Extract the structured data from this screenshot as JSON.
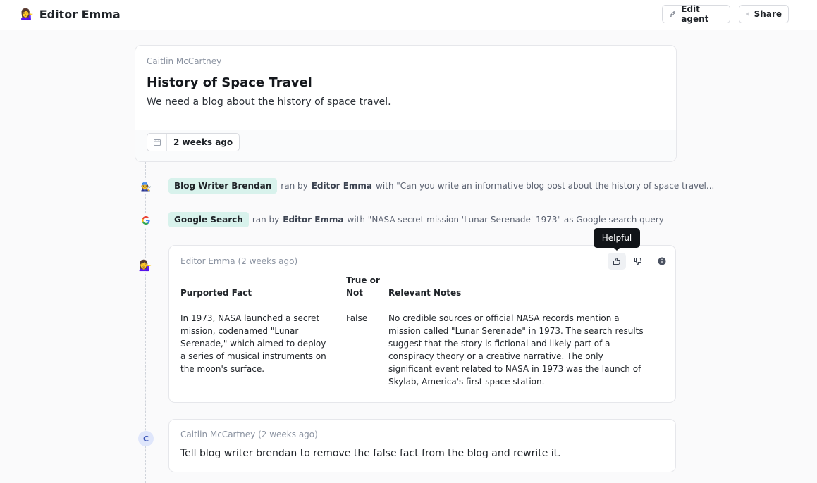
{
  "header": {
    "agent_emoji": "💁‍♀️",
    "agent_name": "Editor Emma",
    "edit_label": "Edit agent",
    "share_label": "Share"
  },
  "task": {
    "author": "Caitlin McCartney",
    "title": "History of Space Travel",
    "description": "We need a blog about the history of space travel.",
    "date": "2 weeks ago"
  },
  "events": [
    {
      "icon": "🧑‍🔧",
      "tool": "Blog Writer Brendan",
      "ran_by_prefix": "ran by",
      "ran_by": "Editor Emma",
      "with_text": "with \"Can you write an informative blog post about the history of space travel..."
    },
    {
      "icon": "google-g-icon",
      "tool": "Google Search",
      "ran_by_prefix": "ran by",
      "ran_by": "Editor Emma",
      "with_text": "with \"NASA secret mission 'Lunar Serenade' 1973\" as Google search query"
    }
  ],
  "agent_message": {
    "avatar": "💁‍♀️",
    "meta": "Editor Emma (2 weeks ago)",
    "tooltip": "Helpful",
    "columns": [
      "Purported Fact",
      "True or Not",
      "Relevant Notes"
    ],
    "rows": [
      {
        "fact": "In 1973, NASA launched a secret mission, codenamed \"Lunar Serenade,\" which aimed to deploy a series of musical instruments on the moon's surface.",
        "verdict": "False",
        "notes": "No credible sources or official NASA records mention a mission called \"Lunar Serenade\" in 1973. The search results suggest that the story is fictional and likely part of a conspiracy theory or a creative narrative. The only significant event related to NASA in 1973 was the launch of Skylab, America's first space station."
      }
    ]
  },
  "user_message": {
    "avatar_letter": "C",
    "meta": "Caitlin McCartney (2 weeks ago)",
    "body": "Tell blog writer brendan to remove the false fact from the blog and rewrite it."
  }
}
